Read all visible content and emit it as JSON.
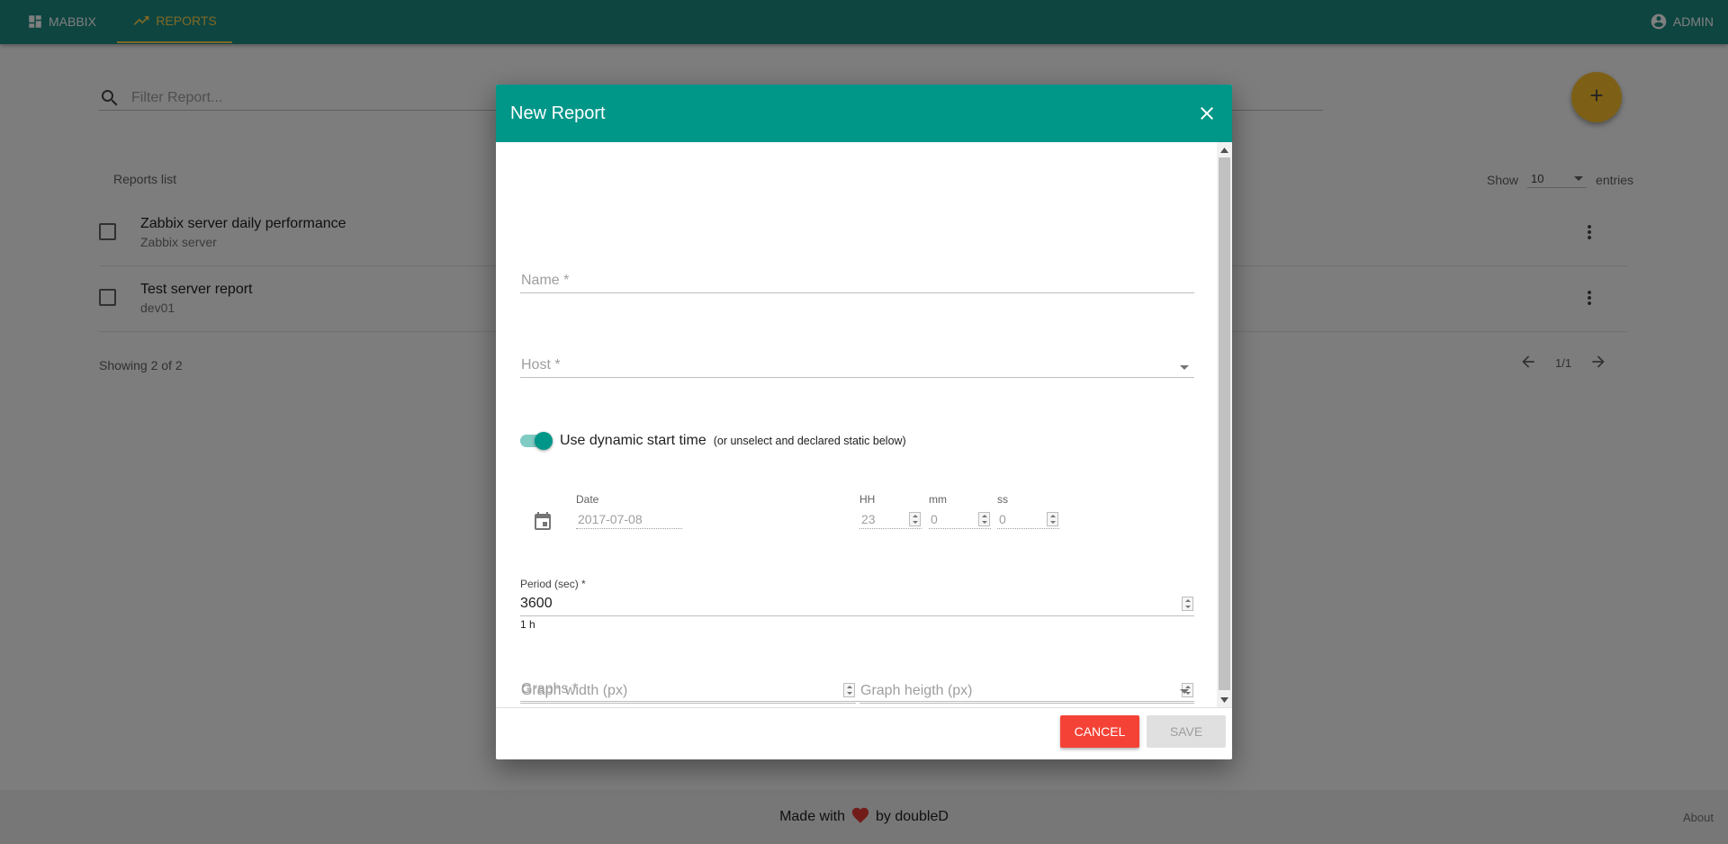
{
  "topbar": {
    "brand_label": "MABBIX",
    "reports_label": "REPORTS",
    "user_label": "ADMIN"
  },
  "filter": {
    "placeholder": "Filter Report..."
  },
  "reports_list": {
    "title": "Reports list",
    "show_label": "Show",
    "entries_value": "10",
    "entries_label": "entries",
    "rows": [
      {
        "title": "Zabbix server daily performance",
        "host": "Zabbix server"
      },
      {
        "title": "Test server report",
        "host": "dev01"
      }
    ],
    "showing": "Showing 2 of 2",
    "page": "1/1"
  },
  "footer": {
    "made_with": "Made with",
    "by": "by doubleD",
    "about": "About"
  },
  "dialog": {
    "title": "New Report",
    "name_placeholder": "Name *",
    "host_placeholder": "Host *",
    "dynamic_toggle_on": true,
    "dynamic_label": "Use dynamic start time",
    "dynamic_hint": "(or unselect and declared static below)",
    "date_label": "Date",
    "date_value": "2017-07-08",
    "hh_label": "HH",
    "hh_value": "23",
    "mm_label": "mm",
    "mm_value": "0",
    "ss_label": "ss",
    "ss_value": "0",
    "period_label": "Period (sec) *",
    "period_value": "3600",
    "period_hint": "1 h",
    "graph_width_placeholder": "Graph width (px)",
    "graph_height_placeholder": "Graph heigth (px)",
    "graphs_placeholder": "Graphs *",
    "cancel_label": "CANCEL",
    "save_label": "SAVE"
  },
  "colors": {
    "primary": "#009688",
    "topbar": "#1d8a80",
    "accent": "#fbc02d",
    "cancel": "#f44336",
    "heart": "#e53935"
  }
}
